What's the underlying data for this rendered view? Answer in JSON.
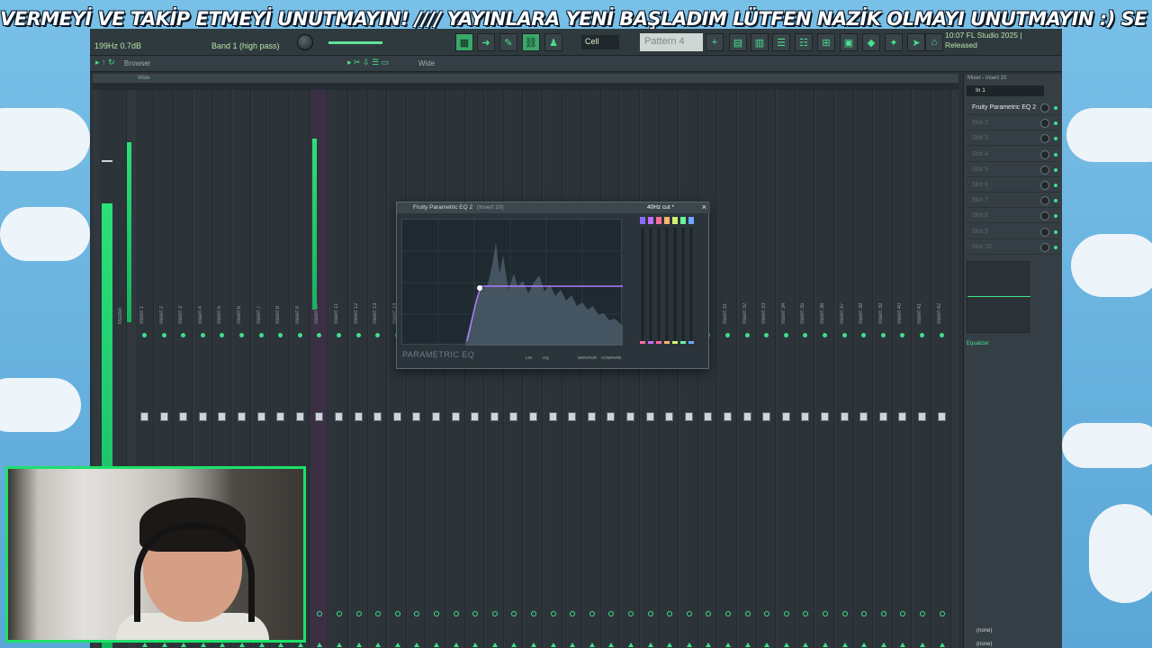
{
  "marquee": {
    "text": "VERMEYİ VE TAKİP ETMEYİ UNUTMAYIN!  ////  YAYINLARA YENİ BAŞLADIM LÜTFEN NAZİK OLMAYI UNUTMAYIN  :)    SE"
  },
  "toolbar": {
    "hint_left": "199Hz 0.7dB",
    "hint_band": "Band 1 (high pass)",
    "snap_label": "Cell",
    "pattern_label": "Pattern 4",
    "hint_right_line1": "10:07  FL Studio 2025 |",
    "hint_right_line2": "Released"
  },
  "browser": {
    "label": "Browser",
    "wide_label": "Wide"
  },
  "mixer": {
    "header_label": "Wide",
    "master_name": "Master",
    "selected_insert": "Insert 10",
    "insert_names": [
      "Insert 1",
      "Insert 2",
      "Insert 3",
      "Insert 4",
      "Insert 5",
      "Insert 6",
      "Insert 7",
      "Insert 8",
      "Insert 9",
      "Insert 10",
      "Insert 11",
      "Insert 12",
      "Insert 13",
      "Insert 14",
      "Insert 15",
      "Insert 16",
      "Insert 17",
      "Insert 18",
      "Insert 19",
      "Insert 20",
      "Insert 21",
      "Insert 22",
      "Insert 23",
      "Insert 24",
      "Insert 25",
      "Insert 26",
      "Insert 27",
      "Insert 28",
      "Insert 29",
      "Insert 30",
      "Insert 31",
      "Insert 32",
      "Insert 33",
      "Insert 34",
      "Insert 35",
      "Insert 36",
      "Insert 37",
      "Insert 38",
      "Insert 39",
      "Insert 40",
      "Insert 41",
      "Insert 42"
    ]
  },
  "eq": {
    "title": "Fruity Parametric EQ 2",
    "title_suffix": "(Insert 10)",
    "preset": "40Hz cut *",
    "logo": "PARAMETRIC EQ",
    "foot_lin": "LIN",
    "foot_hq": "HQ",
    "foot_monitor": "MONITOR",
    "foot_compare": "COMPARE"
  },
  "panel": {
    "title": "Mixer - Insert 10",
    "input": "In 1",
    "slots": [
      "Fruity Parametric EQ 2",
      "Slot 2",
      "Slot 3",
      "Slot 4",
      "Slot 5",
      "Slot 6",
      "Slot 7",
      "Slot 8",
      "Slot 9",
      "Slot 10"
    ],
    "eq_label": "Equalizer",
    "out_none_1": "(none)",
    "out_none_2": "(none)"
  },
  "colors": {
    "accent": "#3fe08a",
    "selected_strip": "#3b2f43",
    "webcam_border": "#1ee06a"
  }
}
